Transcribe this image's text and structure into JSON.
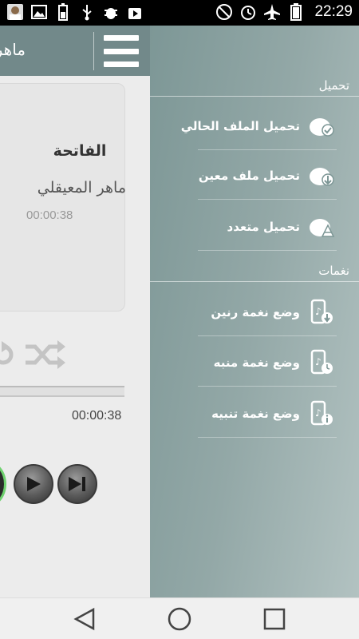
{
  "status_bar": {
    "time": "22:29",
    "left_icons": [
      "avatar-icon",
      "image-icon",
      "battery-saver-icon",
      "usb-icon",
      "bug-icon",
      "play-store-icon"
    ],
    "right_icons": [
      "mute-icon",
      "alarm-icon",
      "airplane-icon",
      "battery-icon"
    ]
  },
  "header": {
    "title": "ماهر"
  },
  "player": {
    "sura": "الفاتحة",
    "reciter": "ماهر المعيقلي",
    "duration": "00:00:38",
    "elapsed": "00:00:38"
  },
  "drawer": {
    "sections": [
      {
        "title": "تحميل",
        "items": [
          {
            "label": "تحميل الملف الحالي",
            "icon": "cloud-check-icon"
          },
          {
            "label": "تحميل ملف معين",
            "icon": "cloud-download-icon"
          },
          {
            "label": "تحميل متعدد",
            "icon": "cloud-multi-icon"
          }
        ]
      },
      {
        "title": "نغمات",
        "items": [
          {
            "label": "وضع نغمة رنين",
            "icon": "ringtone-icon"
          },
          {
            "label": "وضع نغمة منبه",
            "icon": "alarm-tone-icon"
          },
          {
            "label": "وضع نغمة تنبيه",
            "icon": "notification-tone-icon"
          }
        ]
      }
    ]
  },
  "nav_bar": {
    "buttons": [
      "back-icon",
      "home-icon",
      "recents-icon"
    ]
  },
  "colors": {
    "drawer_bg": "#8fa5a4",
    "header_bg": "#72898a",
    "main_bg": "#ececec",
    "play_ring": "#6fd26f"
  }
}
